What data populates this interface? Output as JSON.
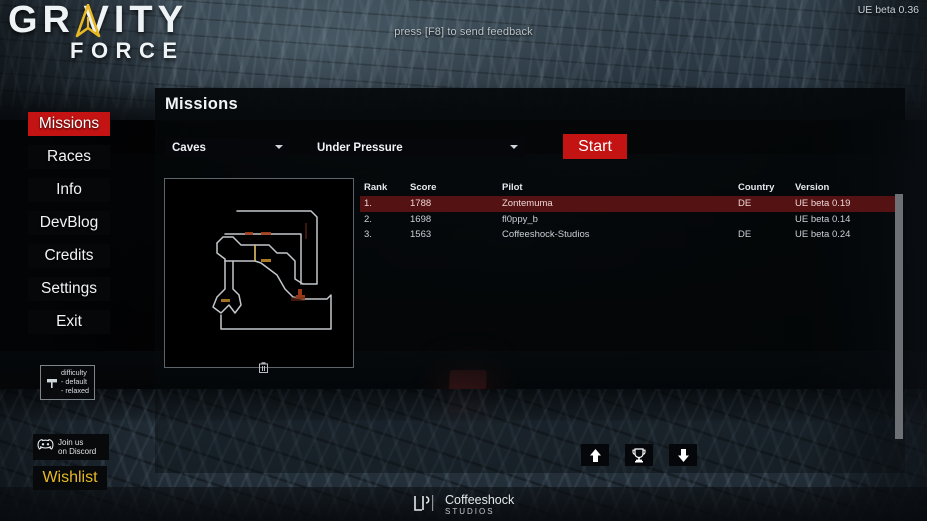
{
  "topbar": {
    "feedback_hint": "press [F8] to send feedback",
    "version": "UE beta 0.36"
  },
  "logo": {
    "line1_pre": "GR",
    "line1_post": "VITY",
    "line2": "FORCE",
    "accent_color": "#e8b924"
  },
  "sidebar": {
    "items": [
      {
        "label": "Missions",
        "active": true
      },
      {
        "label": "Races",
        "active": false
      },
      {
        "label": "Info",
        "active": false
      },
      {
        "label": "DevBlog",
        "active": false
      },
      {
        "label": "Credits",
        "active": false
      },
      {
        "label": "Settings",
        "active": false
      },
      {
        "label": "Exit",
        "active": false
      }
    ],
    "active_color": "#c41313"
  },
  "difficulty": {
    "title": "difficulty",
    "option_default": "- default",
    "option_relaxed": "- relaxed"
  },
  "discord": {
    "line1": "Join us",
    "line2": "on Discord"
  },
  "wishlist": {
    "label": "Wishlist",
    "color": "#e8b924"
  },
  "panel": {
    "title": "Missions",
    "world_dropdown": "Caves",
    "mission_dropdown": "Under Pressure",
    "start_label": "Start"
  },
  "leaderboard": {
    "columns": [
      "Rank",
      "Score",
      "Pilot",
      "Country",
      "Version"
    ],
    "rows": [
      {
        "rank": "1.",
        "score": "1788",
        "pilot": "Zontemuma",
        "country": "DE",
        "version": "UE beta 0.19",
        "highlight": true
      },
      {
        "rank": "2.",
        "score": "1698",
        "pilot": "fl0ppy_b",
        "country": "",
        "version": "UE beta 0.14",
        "highlight": false
      },
      {
        "rank": "3.",
        "score": "1563",
        "pilot": "Coffeeshock-Studios",
        "country": "DE",
        "version": "UE beta 0.24",
        "highlight": false
      }
    ],
    "highlight_color": "#541212"
  },
  "tools": {
    "up_icon": "arrow-up-icon",
    "trophy_icon": "trophy-icon",
    "down_icon": "arrow-down-icon"
  },
  "map_preview": {
    "delete_icon": "trash-icon"
  },
  "studio": {
    "name": "Coffeeshock",
    "sub": "STUDIOS"
  }
}
